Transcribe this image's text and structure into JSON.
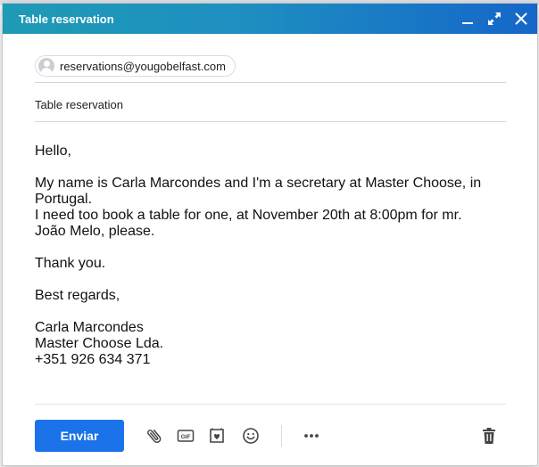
{
  "window": {
    "title": "Table reservation"
  },
  "recipients": [
    {
      "email": "reservations@yougobelfast.com"
    }
  ],
  "subject": "Table reservation",
  "body": {
    "greeting": "Hello,",
    "para1_line1": "My name is Carla Marcondes and I'm a secretary at Master Choose, in",
    "para1_line2": "Portugal.",
    "para1_line3": "I need too book a table for one, at November 20th at 8:00pm for mr.",
    "para1_line4": "João Melo, please.",
    "thanks": "Thank you.",
    "closing": "Best regards,",
    "sig_name": "Carla Marcondes",
    "sig_company": "Master Choose Lda.",
    "sig_phone": "+351 926 634 371"
  },
  "toolbar": {
    "send_label": "Enviar",
    "gif_label": "GIF",
    "icons": [
      "attach-icon",
      "gif-icon",
      "sticker-icon",
      "emoji-icon",
      "more-icon",
      "trash-icon"
    ]
  }
}
